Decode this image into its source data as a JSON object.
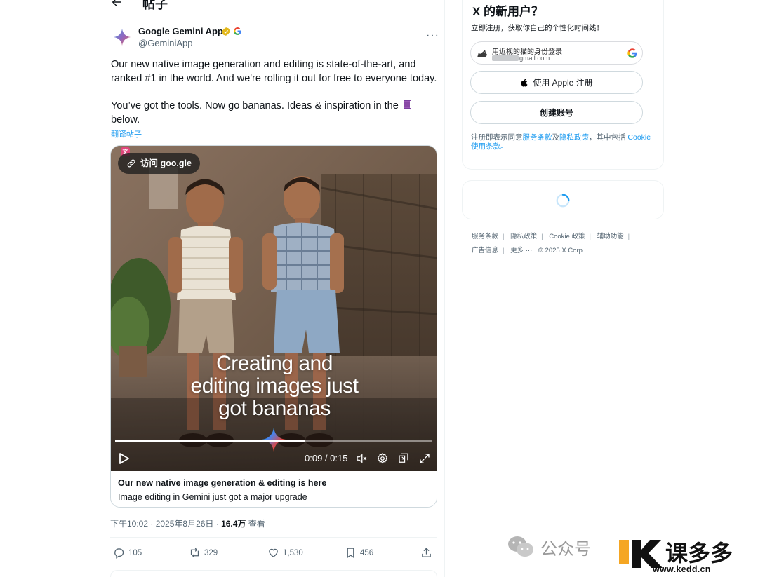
{
  "header": {
    "title": "帖子"
  },
  "tweet": {
    "display_name": "Google Gemini App",
    "handle": "@GeminiApp",
    "paragraph1": "Our new native image generation and editing is state-of-the-art, and ranked #1 in the world. And we're rolling it out for free to everyone today.",
    "paragraph2": "You’ve got the tools. Now go bananas. Ideas & inspiration in the",
    "paragraph2_tail": "below.",
    "translate": "翻译帖子",
    "media": {
      "visit_label": "访问 goo.gle",
      "headline_line1": "Creating and",
      "headline_line2": "editing images just",
      "headline_line3": "got bananas",
      "time": "0:09 / 0:15",
      "progress": 0.6,
      "card_title": "Our new native image generation & editing is here",
      "card_desc": "Image editing in Gemini just got a major upgrade"
    },
    "timestamp": "下午10:02 · 2025年8月26日 · ",
    "views_count": "16.4万",
    "views_label": " 查看",
    "actions": {
      "replies": "105",
      "reposts": "329",
      "likes": "1,530",
      "bookmarks": "456"
    }
  },
  "signup": {
    "title": "X 的新用户？",
    "subtitle": "立即注册，获取你自己的个性化时间线！",
    "google_line1": "用近视的猫的身份登录",
    "google_line2": "gmail.com",
    "apple_label": "使用 Apple 注册",
    "create_label": "创建账号",
    "terms_prefix": "注册即表示同意",
    "terms_tos": "服务条款",
    "terms_and": "及",
    "terms_privacy": "隐私政策",
    "terms_mid": "，其中包括 ",
    "terms_cookie": "Cookie 使用条款。"
  },
  "footer": {
    "links": [
      "服务条款",
      "隐私政策",
      "Cookie 政策",
      "辅助功能",
      "广告信息",
      "更多 ···"
    ],
    "copyright": "© 2025 X Corp."
  },
  "watermark": {
    "label": "公众号",
    "url": "www.kedd.cn"
  },
  "colors": {
    "accent": "#1d9bf0",
    "text": "#0f1419",
    "muted": "#536471"
  }
}
